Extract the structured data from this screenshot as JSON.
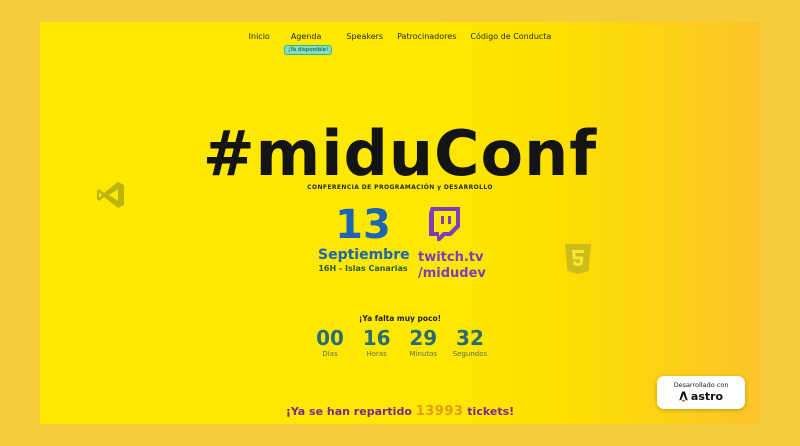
{
  "nav": {
    "items": [
      {
        "label": "Inicio"
      },
      {
        "label": "Agenda",
        "badge": "¡Ya disponible!"
      },
      {
        "label": "Speakers"
      },
      {
        "label": "Patrocinadores"
      },
      {
        "label": "Código de Conducta"
      }
    ]
  },
  "hero": {
    "title": "#miduConf",
    "subtitle": "CONFERENCIA DE PROGRAMACIÓN y DESARROLLO"
  },
  "event": {
    "day": "13",
    "month": "Septiembre",
    "time": "16H - Islas Canarias",
    "stream_line1": "twitch.tv",
    "stream_line2": "/midudev"
  },
  "countdown": {
    "label": "¡Ya falta muy poco!",
    "units": [
      {
        "value": "00",
        "label": "Días"
      },
      {
        "value": "16",
        "label": "Horas"
      },
      {
        "value": "29",
        "label": "Minutos"
      },
      {
        "value": "32",
        "label": "Segundos"
      }
    ]
  },
  "tickets": {
    "prefix": "¡Ya se han repartido",
    "count": "13993",
    "suffix": "tickets!"
  },
  "astro_badge": {
    "caption": "Desarrollado con",
    "brand": "astro"
  },
  "icons": [
    "vscode-icon",
    "twitch-icon",
    "html5-icon",
    "astro-icon"
  ],
  "colors": {
    "background": "#fde800",
    "accent_blue": "#1d65b0",
    "twitch_purple": "#7c3fb8",
    "ticket_count": "#e39a1b"
  }
}
